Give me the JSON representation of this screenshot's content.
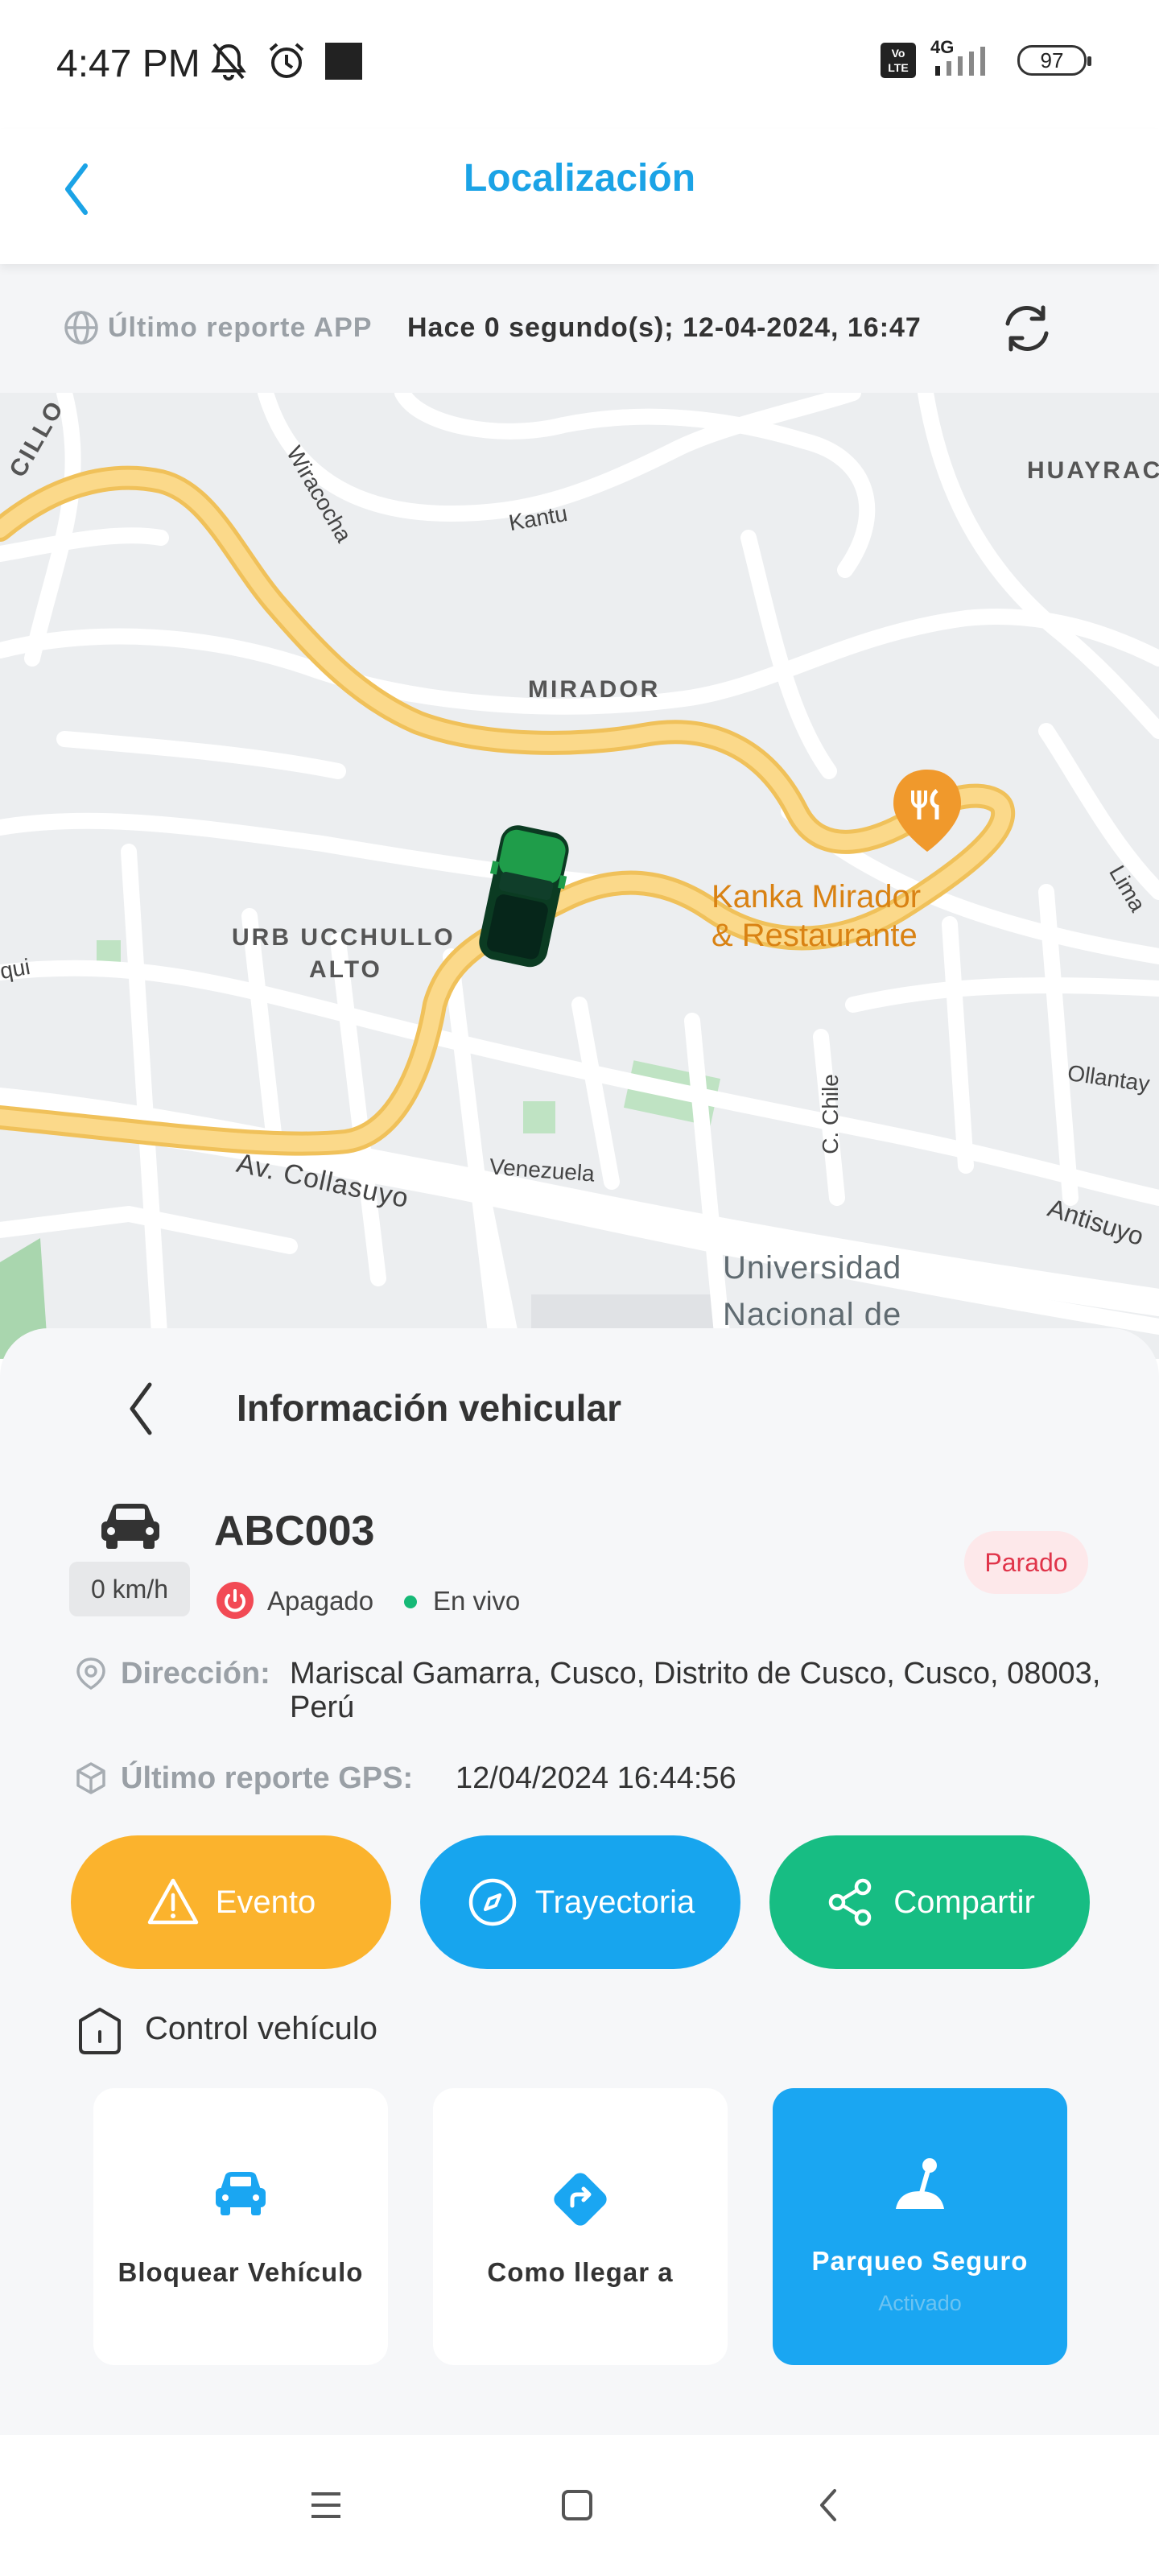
{
  "status_bar": {
    "time": "4:47 PM",
    "network": "4G",
    "volte": "Vo LTE",
    "battery": "97"
  },
  "header": {
    "title": "Localización",
    "back_icon": "chevron-left-icon"
  },
  "report": {
    "label": "Último reporte APP",
    "value": "Hace 0 segundo(s); 12-04-2024, 16:47",
    "refresh_icon": "refresh-icon"
  },
  "map": {
    "neighborhoods": [
      "MIRADOR",
      "URB UCCHULLO",
      "ALTO",
      "HUAYRAC",
      "CILLO"
    ],
    "streets": [
      "Wiracocha",
      "Kantu",
      "Av. Collasuyo",
      "Venezuela",
      "C. Chile",
      "Ollantay",
      "Antisuyo",
      "Lima",
      "qui"
    ],
    "poi": {
      "line1": "Kanka Mirador",
      "line2": "& Restaurante",
      "icon": "restaurant-icon"
    },
    "university": {
      "line1": "Universidad",
      "line2": "Nacional de"
    }
  },
  "vehicle_info": {
    "title": "Información vehicular",
    "plate": "ABC003",
    "speed": "0 km/h",
    "status": "Parado",
    "engine": "Apagado",
    "live": "En vivo",
    "address_label": "Dirección:",
    "address_value": "Mariscal Gamarra, Cusco, Distrito de Cusco, Cusco, 08003, Perú",
    "gps_label": "Último reporte GPS:",
    "gps_value": "12/04/2024 16:44:56",
    "colors": {
      "status_bg": "#fde8ea",
      "status_text": "#e0344a",
      "live_dot": "#16b977"
    }
  },
  "actions": [
    {
      "label": "Evento",
      "icon": "warning-icon",
      "color": "#fbb32d"
    },
    {
      "label": "Trayectoria",
      "icon": "compass-icon",
      "color": "#17a5ee"
    },
    {
      "label": "Compartir",
      "icon": "share-icon",
      "color": "#17bd83"
    }
  ],
  "control": {
    "title": "Control vehículo",
    "cards": [
      {
        "label": "Bloquear Vehículo",
        "sublabel": "",
        "icon": "car-lock-icon"
      },
      {
        "label": "Como llegar a",
        "sublabel": "",
        "icon": "directions-icon"
      },
      {
        "label": "Parqueo Seguro",
        "sublabel": "Activado",
        "icon": "parking-lever-icon"
      }
    ]
  },
  "nav": [
    "menu-icon",
    "home-square-icon",
    "back-icon"
  ]
}
